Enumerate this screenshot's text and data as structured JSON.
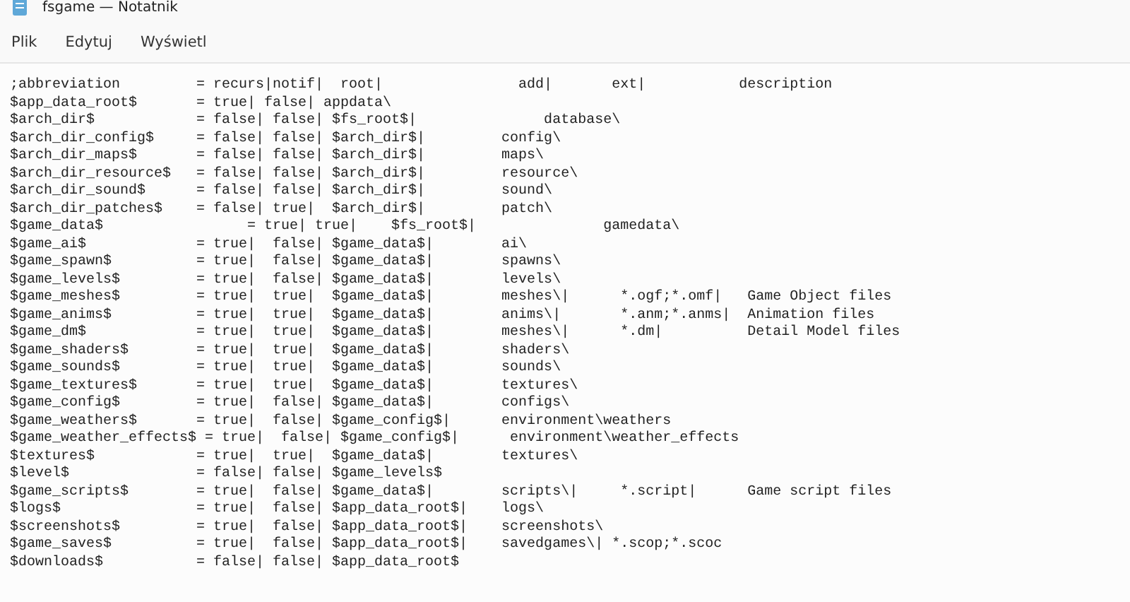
{
  "window": {
    "title": "fsgame — Notatnik"
  },
  "menu": [
    "Plik",
    "Edytuj",
    "Wyświetl"
  ],
  "lines": [
    ";abbreviation         = recurs|notif|  root|                add|       ext|           description",
    "$app_data_root$       = true| false| appdata\\",
    "$arch_dir$            = false| false| $fs_root$|               database\\",
    "$arch_dir_config$     = false| false| $arch_dir$|         config\\",
    "$arch_dir_maps$       = false| false| $arch_dir$|         maps\\",
    "$arch_dir_resource$   = false| false| $arch_dir$|         resource\\",
    "$arch_dir_sound$      = false| false| $arch_dir$|         sound\\",
    "$arch_dir_patches$    = false| true|  $arch_dir$|         patch\\",
    "$game_data$                 = true| true|    $fs_root$|               gamedata\\",
    "$game_ai$             = true|  false| $game_data$|        ai\\",
    "$game_spawn$          = true|  false| $game_data$|        spawns\\",
    "$game_levels$         = true|  false| $game_data$|        levels\\",
    "$game_meshes$         = true|  true|  $game_data$|        meshes\\|      *.ogf;*.omf|   Game Object files",
    "$game_anims$          = true|  true|  $game_data$|        anims\\|       *.anm;*.anms|  Animation files",
    "$game_dm$             = true|  true|  $game_data$|        meshes\\|      *.dm|          Detail Model files",
    "$game_shaders$        = true|  true|  $game_data$|        shaders\\",
    "$game_sounds$         = true|  true|  $game_data$|        sounds\\",
    "$game_textures$       = true|  true|  $game_data$|        textures\\",
    "$game_config$         = true|  false| $game_data$|        configs\\",
    "$game_weathers$       = true|  false| $game_config$|      environment\\weathers",
    "$game_weather_effects$ = true|  false| $game_config$|      environment\\weather_effects",
    "$textures$            = true|  true|  $game_data$|        textures\\",
    "$level$               = false| false| $game_levels$",
    "$game_scripts$        = true|  false| $game_data$|        scripts\\|     *.script|      Game script files",
    "$logs$                = true|  false| $app_data_root$|    logs\\",
    "$screenshots$         = true|  false| $app_data_root$|    screenshots\\",
    "$game_saves$          = true|  false| $app_data_root$|    savedgames\\| *.scop;*.scoc",
    "$downloads$           = false| false| $app_data_root$"
  ]
}
